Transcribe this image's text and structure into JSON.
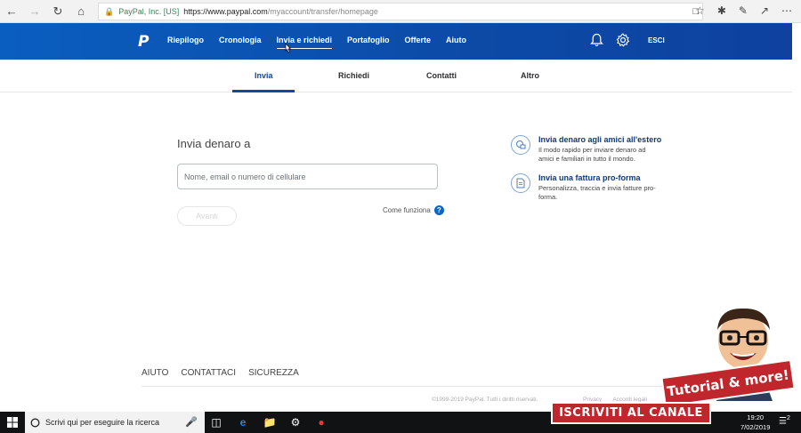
{
  "browser": {
    "site_identity": "PayPal, Inc. [US]",
    "url_domain": "https://www.paypal.com",
    "url_path": "/myaccount/transfer/homepage"
  },
  "header": {
    "nav": [
      "Riepilogo",
      "Cronologia",
      "Invia e richiedi",
      "Portafoglio",
      "Offerte",
      "Aiuto"
    ],
    "active_nav": "Invia e richiedi",
    "logout": "ESCI"
  },
  "subnav": {
    "tabs": [
      "Invia",
      "Richiedi",
      "Contatti",
      "Altro"
    ],
    "active": "Invia"
  },
  "form": {
    "title": "Invia denaro a",
    "placeholder": "Nome, email o numero di cellulare",
    "next_button": "Avanti",
    "help_link": "Come funziona",
    "help_icon": "?"
  },
  "promos": [
    {
      "icon": "globe-money-icon",
      "title": "Invia denaro agli amici all'estero",
      "description": "Il modo rapido per inviare denaro ad amici e familiari in tutto il mondo."
    },
    {
      "icon": "invoice-icon",
      "title": "Invia una fattura pro-forma",
      "description": "Personalizza, traccia e invia fatture pro-forma."
    }
  ],
  "footer": {
    "links": [
      "AIUTO",
      "CONTATTACI",
      "SICUREZZA"
    ],
    "copyright": "©1999-2019 PayPal. Tutti i diritti riservati.",
    "legal_links": [
      "Privacy",
      "Accordi legali"
    ]
  },
  "taskbar": {
    "search_placeholder": "Scrivi qui per eseguire la ricerca",
    "time": "19:20",
    "date": "7/02/2019",
    "notifications": "2"
  },
  "overlay": {
    "tutorial": "Tutorial & more!",
    "subscribe": "ISCRIVITI AL CANALE"
  },
  "colors": {
    "header_blue": "#0c4aa6",
    "link_blue": "#0c66c8",
    "banner_red": "#c0272d"
  }
}
